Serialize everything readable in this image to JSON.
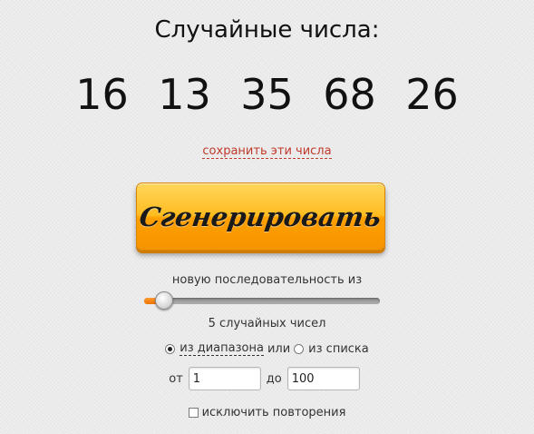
{
  "title": "Случайные числа:",
  "numbers": [
    "16",
    "13",
    "35",
    "68",
    "26"
  ],
  "save_link": "сохранить эти числа",
  "generate_button": "Сгенерировать",
  "sequence_label": "новую последовательность из",
  "slider": {
    "value": 5,
    "fill_fraction": 0.08,
    "accent_color": "#f08a1c"
  },
  "count_label": "5 случайных чисел",
  "source": {
    "range_option": "из диапазона",
    "separator": "или",
    "list_option": "из списка",
    "selected": "range"
  },
  "range": {
    "from_label": "от",
    "from_value": "1",
    "to_label": "до",
    "to_value": "100"
  },
  "exclude_repeats": {
    "label": "исключить повторения",
    "checked": false
  },
  "colors": {
    "link": "#c0392b",
    "button": "#ffb01e"
  }
}
